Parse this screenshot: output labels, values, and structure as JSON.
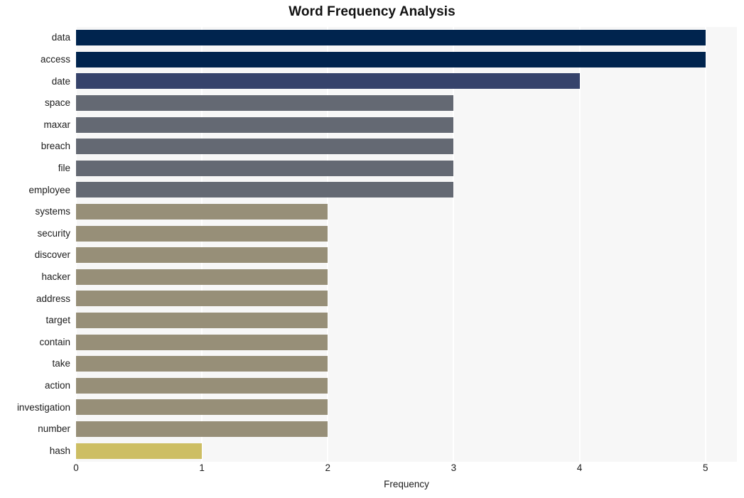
{
  "chart_data": {
    "type": "bar",
    "orientation": "horizontal",
    "title": "Word Frequency Analysis",
    "xlabel": "Frequency",
    "ylabel": "",
    "xlim": [
      0,
      5.25
    ],
    "xticks": [
      0,
      1,
      2,
      3,
      4,
      5
    ],
    "xtick_labels": [
      "0",
      "1",
      "2",
      "3",
      "4",
      "5"
    ],
    "grid": true,
    "grid_axis": "x",
    "legend": "none",
    "categories": [
      "data",
      "access",
      "date",
      "space",
      "maxar",
      "breach",
      "file",
      "employee",
      "systems",
      "security",
      "discover",
      "hacker",
      "address",
      "target",
      "contain",
      "take",
      "action",
      "investigation",
      "number",
      "hash"
    ],
    "values": [
      5,
      5,
      4,
      3,
      3,
      3,
      3,
      3,
      2,
      2,
      2,
      2,
      2,
      2,
      2,
      2,
      2,
      2,
      2,
      1
    ],
    "bar_colors": [
      "#00244e",
      "#00244e",
      "#36436b",
      "#646973",
      "#646973",
      "#646973",
      "#646973",
      "#646973",
      "#978f78",
      "#978f78",
      "#978f78",
      "#978f78",
      "#978f78",
      "#978f78",
      "#978f78",
      "#978f78",
      "#978f78",
      "#978f78",
      "#978f78",
      "#cdbe63"
    ]
  },
  "style": {
    "plot_background": "#f7f7f7",
    "figure_background": "#ffffff",
    "gridline_color": "#ffffff",
    "text_color": "#1c1c1c",
    "title_color": "#111111"
  }
}
